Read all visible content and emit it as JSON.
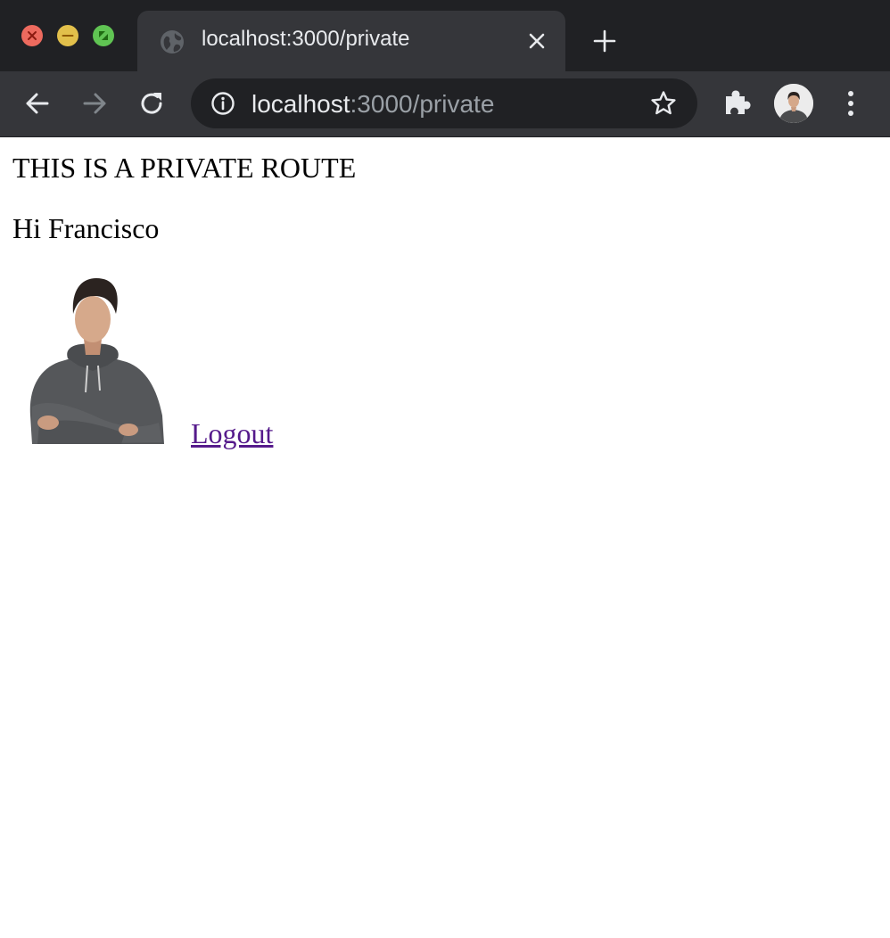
{
  "browser": {
    "tab": {
      "title": "localhost:3000/private",
      "favicon": "globe-icon"
    },
    "omnibox": {
      "url_host": "localhost",
      "url_rest": ":3000/private"
    },
    "icons": {
      "back": "arrow-left-icon",
      "forward": "arrow-right-icon",
      "reload": "reload-icon",
      "info": "info-icon",
      "bookmark": "star-icon",
      "extensions": "puzzle-icon",
      "menu": "kebab-menu-icon",
      "new_tab": "plus-icon",
      "close_tab": "close-icon"
    },
    "colors": {
      "frame": "#202124",
      "toolbar": "#35363a",
      "close": "#ed6a5e",
      "minimize": "#e2c04b",
      "maximize": "#60c453"
    }
  },
  "page": {
    "heading": "THIS IS A PRIVATE ROUTE",
    "greeting": "Hi Francisco",
    "logout_label": "Logout",
    "link_color": "#551a8b"
  }
}
